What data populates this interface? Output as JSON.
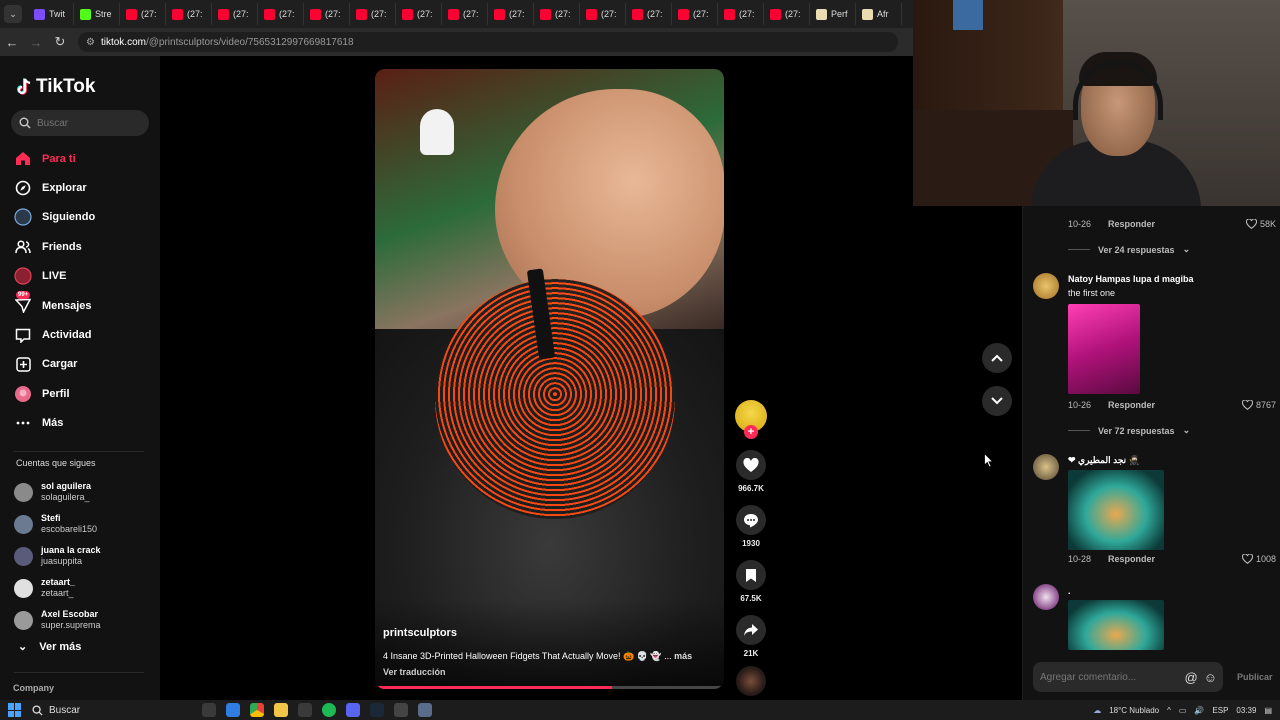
{
  "browser": {
    "tabs": [
      {
        "label": "Twit",
        "color": "#7b4dff"
      },
      {
        "label": "Stre",
        "color": "#53fc18"
      },
      {
        "label": "(27:",
        "color": "#ff0033"
      },
      {
        "label": "(27:",
        "color": "#ff0033"
      },
      {
        "label": "(27:",
        "color": "#ff0033"
      },
      {
        "label": "(27:",
        "color": "#ff0033"
      },
      {
        "label": "(27:",
        "color": "#ff0033"
      },
      {
        "label": "(27:",
        "color": "#ff0033"
      },
      {
        "label": "(27:",
        "color": "#ff0033"
      },
      {
        "label": "(27:",
        "color": "#ff0033"
      },
      {
        "label": "(27:",
        "color": "#ff0033"
      },
      {
        "label": "(27:",
        "color": "#ff0033"
      },
      {
        "label": "(27:",
        "color": "#ff0033"
      },
      {
        "label": "(27:",
        "color": "#ff0033"
      },
      {
        "label": "(27:",
        "color": "#ff0033"
      },
      {
        "label": "(27:",
        "color": "#ff0033"
      },
      {
        "label": "(27:",
        "color": "#ff0033"
      },
      {
        "label": "Perf",
        "color": "#e8dcb0"
      },
      {
        "label": "Afr",
        "color": "#e8dcb0"
      }
    ],
    "url_host": "tiktok.com",
    "url_path": "/@printsculptors/video/7565312997669817618"
  },
  "sidebar": {
    "brand": "TikTok",
    "search_placeholder": "Buscar",
    "nav": [
      {
        "label": "Para ti",
        "icon": "home-icon",
        "active": true
      },
      {
        "label": "Explorar",
        "icon": "compass-icon"
      },
      {
        "label": "Siguiendo",
        "icon": "following-avatar-icon"
      },
      {
        "label": "Friends",
        "icon": "friends-icon"
      },
      {
        "label": "LIVE",
        "icon": "live-icon"
      },
      {
        "label": "Mensajes",
        "icon": "messages-icon",
        "badge": "99+"
      },
      {
        "label": "Actividad",
        "icon": "activity-icon"
      },
      {
        "label": "Cargar",
        "icon": "upload-icon"
      },
      {
        "label": "Perfil",
        "icon": "profile-icon"
      },
      {
        "label": "Más",
        "icon": "more-icon"
      }
    ],
    "following_title": "Cuentas que sigues",
    "following": [
      {
        "name": "sol aguilera",
        "handle": "solaguilera_",
        "color": "#8a8a8a"
      },
      {
        "name": "Stefi",
        "handle": "escobareli150",
        "color": "#6b7a90"
      },
      {
        "name": "juana la crack",
        "handle": "juasuppita",
        "color": "#5a5a7a"
      },
      {
        "name": "zetaart_",
        "handle": "zetaart_",
        "color": "#e0e0e0"
      },
      {
        "name": "Axel Escobar",
        "handle": "super.suprema",
        "color": "#9a9a9a"
      }
    ],
    "see_more": "Ver más",
    "company": "Company"
  },
  "video": {
    "author": "printsculptors",
    "description": "4 Insane 3D-Printed Halloween Fidgets That Actually Move! 🎃 💀 👻 ...",
    "more": "más",
    "translate": "Ver traducción",
    "progress": 0.68
  },
  "actions": {
    "likes": "966.7K",
    "comments": "1930",
    "saves": "67.5K",
    "shares": "21K"
  },
  "comments": {
    "c0": {
      "date": "10-26",
      "reply": "Responder",
      "likes": "58K"
    },
    "r0": "Ver 24 respuestas",
    "c1": {
      "user": "Natoy Hampas lupa d magiba",
      "text": "the first one",
      "date": "10-26",
      "reply": "Responder",
      "likes": "8767"
    },
    "r1": "Ver 72 respuestas",
    "c2": {
      "user": "❤ نجد المطيري 🥷🏻",
      "date": "10-28",
      "reply": "Responder",
      "likes": "1008"
    },
    "c3": {
      "user": "."
    },
    "input_placeholder": "Agregar comentario...",
    "publish": "Publicar"
  },
  "taskbar": {
    "search": "Buscar",
    "weather": "18°C  Nublado",
    "lang": "ESP",
    "time": "03:39"
  }
}
